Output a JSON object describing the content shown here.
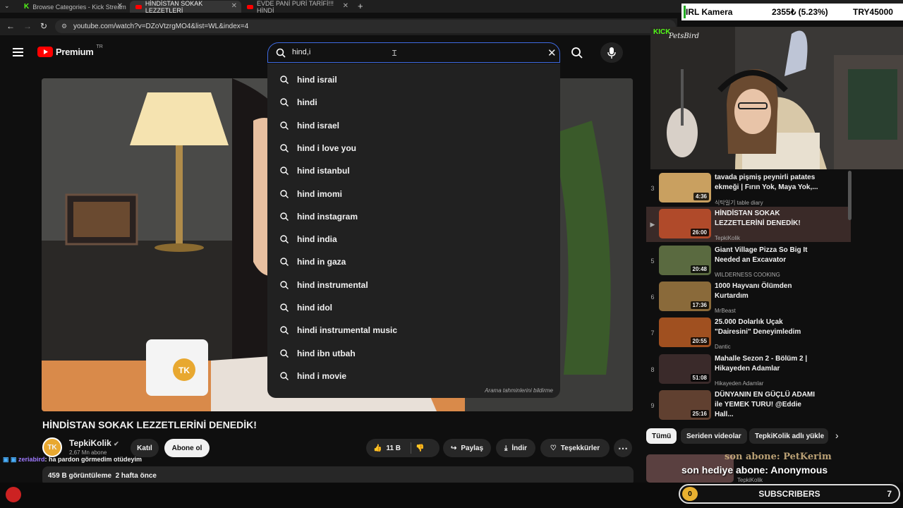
{
  "browser": {
    "tabs": [
      {
        "label": "Browse Categories - Kick Stream",
        "active": false
      },
      {
        "label": "HİNDİSTAN SOKAK LEZZETLERİ",
        "active": true
      },
      {
        "label": "EVDE PANİ PURİ TARİFİ!!! HİNDİ",
        "active": false
      }
    ],
    "url": "youtube.com/watch?v=DZoVtzrgMO4&list=WL&index=4",
    "new_tab": "+"
  },
  "header": {
    "logo": "Premium",
    "region": "TR",
    "search_value": "hind,i"
  },
  "suggestions": [
    "hind israil",
    "hindi",
    "hind israel",
    "hind i love you",
    "hind istanbul",
    "hind imomi",
    "hind instagram",
    "hind india",
    "hind in gaza",
    "hind instrumental",
    "hind idol",
    "hindi instrumental music",
    "hind ibn utbah",
    "hind i movie"
  ],
  "report_text": "Arama tahminlerini bildirme",
  "video": {
    "title": "HİNDİSTAN SOKAK LEZZETLERİNİ DENEDİK!",
    "channel": "TepkiKolik",
    "subs": "2,67 Mn abone",
    "join": "Katıl",
    "subscribe": "Abone ol",
    "likes": "11 B",
    "share": "Paylaş",
    "download": "İndir",
    "thanks": "Teşekkürler",
    "views": "459 B görüntüleme",
    "age": "2 hafta önce",
    "mug_logo": "TK"
  },
  "playlist": [
    {
      "n": "3",
      "title": "tavada pişmiş peynirli patates ekmeği | Fırın Yok, Maya Yok,...",
      "channel": "식탁일기 table diary",
      "dur": "4:36",
      "color": "#c9a060"
    },
    {
      "n": "▶",
      "title": "HİNDİSTAN SOKAK LEZZETLERİNİ DENEDİK!",
      "channel": "TepkiKolik",
      "dur": "26:00",
      "color": "#b04a2a"
    },
    {
      "n": "5",
      "title": "Giant Village Pizza So Big It Needed an Excavator",
      "channel": "WILDERNESS COOKING",
      "dur": "20:48",
      "color": "#5a6a40"
    },
    {
      "n": "6",
      "title": "1000 Hayvanı Ölümden Kurtardım",
      "channel": "MrBeast",
      "dur": "17:36",
      "color": "#8a6a3a"
    },
    {
      "n": "7",
      "title": "25.000 Dolarlık Uçak \"Dairesini\" Deneyimledim",
      "channel": "Dantic",
      "dur": "20:55",
      "color": "#a05020"
    },
    {
      "n": "8",
      "title": "Mahalle Sezon 2 - Bölüm 2 | Hikayeden Adamlar",
      "channel": "Hikayeden Adamlar",
      "dur": "51:08",
      "color": "#3a2a2a"
    },
    {
      "n": "9",
      "title": "DÜNYANIN EN GÜÇLÜ ADAMI ile YEMEK TURU! @Eddie Hall...",
      "channel": "",
      "dur": "25:16",
      "color": "#604030"
    }
  ],
  "chips": [
    "Tümü",
    "Seriden videolar",
    "TepkiKolik adlı yükle"
  ],
  "stream": {
    "irl_label": "IRL Kamera",
    "price": "2355₺ (5.23%)",
    "goal": "TRY45000",
    "kick_logo": "KICK",
    "streamer": "PetsBird",
    "subs_label": "SUBSCRIBERS",
    "subs_left": "0",
    "subs_right": "7",
    "overlay_text": "son hediye abone: Anonymous",
    "overlay_text2": "son abone: PetKerim",
    "chat_user": "zeriabird",
    "chat_msg": ": ha pardon görmedim otüdeyim",
    "bottom_card_channel": "TepkiKolik"
  },
  "colors": {
    "accent": "#3e6ae1",
    "youtube_red": "#ff0000",
    "bg": "#0f0f0f"
  }
}
